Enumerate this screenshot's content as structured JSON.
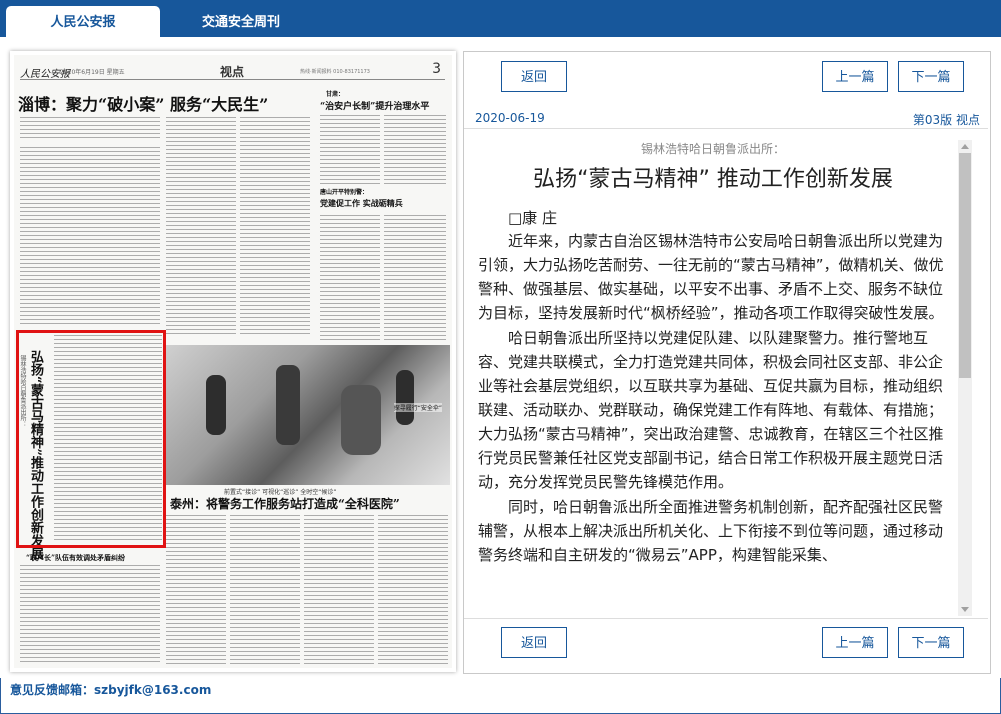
{
  "tabs": [
    {
      "label": "人民公安报",
      "active": true
    },
    {
      "label": "交通安全周刊",
      "active": false
    }
  ],
  "newspaper": {
    "logo": "人民公安报",
    "date": "2020年6月19日 星期五",
    "section": "视点",
    "contact": "热线·新闻报料 010-83171173",
    "page_number": "3",
    "headline_main": "淄博：聚力“破小案”  服务“大民生”",
    "headline_right_kicker": "甘肃：",
    "headline_right": "“治安户长制”提升治理水平",
    "headline_middle": "唐山开平特别警：",
    "headline_middle2": "党建促工作  实战砺精兵",
    "vertical_title": "弘扬“蒙古马精神”推动工作创新发展",
    "vertical_subtitle": "锡林浩特哈日朝鲁派出所：",
    "photo_caption": "探寻履行“安全伞”",
    "caption_bottom": "前置式“接诊”  可视化“巡诊”  全时空“候诊”",
    "headline_taizhou": "泰州：将警务工作服务站打造成“全科医院”",
    "headline_lower_left": "“联户长”队伍有效调处矛盾纠纷"
  },
  "article": {
    "buttons": {
      "back": "返回",
      "prev": "上一篇",
      "next": "下一篇"
    },
    "date": "2020-06-19",
    "page_label": "第03版 视点",
    "subtitle": "锡林浩特哈日朝鲁派出所：",
    "title": "弘扬“蒙古马精神”  推动工作创新发展",
    "author": "□康  庄",
    "paragraphs": [
      "近年来，内蒙古自治区锡林浩特市公安局哈日朝鲁派出所以党建为引领，大力弘扬吃苦耐劳、一往无前的“蒙古马精神”，做精机关、做优警种、做强基层、做实基础，以平安不出事、矛盾不上交、服务不缺位为目标，坚持发展新时代“枫桥经验”，推动各项工作取得突破性发展。",
      "哈日朝鲁派出所坚持以党建促队建、以队建聚警力。推行警地互容、党建共联模式，全力打造党建共同体，积极会同社区支部、非公企业等社会基层党组织，以互联共享为基础、互促共赢为目标，推动组织联建、活动联办、党群联动，确保党建工作有阵地、有载体、有措施；大力弘扬“蒙古马精神”，突出政治建警、忠诚教育，在辖区三个社区推行党员民警兼任社区党支部副书记，结合日常工作积极开展主题党日活动，充分发挥党员民警先锋模范作用。",
      "同时，哈日朝鲁派出所全面推进警务机制创新，配齐配强社区民警辅警，从根本上解决派出所机关化、上下衔接不到位等问题，通过移动警务终端和自主研发的“微易云”APP，构建智能采集、"
    ]
  },
  "footer": {
    "label": "意见反馈邮箱：szbyjfk@163.com"
  }
}
